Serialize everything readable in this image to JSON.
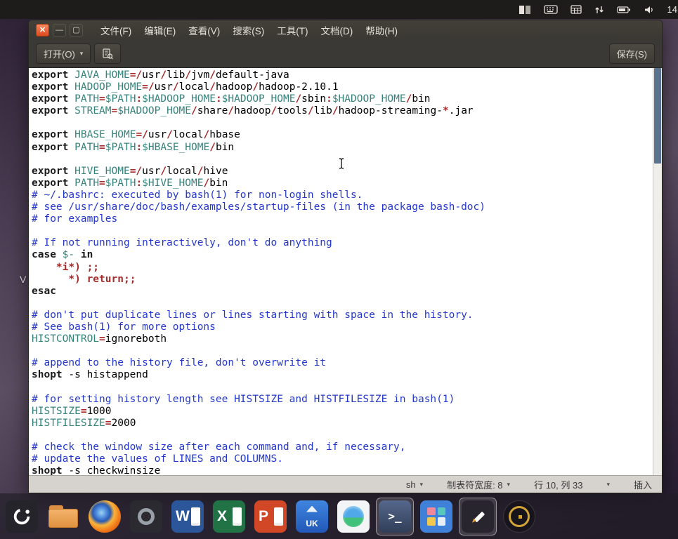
{
  "top_panel": {
    "clock": "14",
    "icons": [
      "input-method",
      "keyboard",
      "calendar",
      "sync-arrows",
      "battery",
      "volume"
    ]
  },
  "desktop": {
    "fragment_label": "V"
  },
  "window": {
    "titlebar": {
      "menus": [
        {
          "label": "文件(F)"
        },
        {
          "label": "编辑(E)"
        },
        {
          "label": "查看(V)"
        },
        {
          "label": "搜索(S)"
        },
        {
          "label": "工具(T)"
        },
        {
          "label": "文档(D)"
        },
        {
          "label": "帮助(H)"
        }
      ]
    },
    "toolbar": {
      "open_label": "打开(O)",
      "save_label": "保存(S)"
    },
    "statusbar": {
      "language_mode": "sh",
      "tab_width": "制表符宽度: 8",
      "cursor_position": "行 10, 列 33",
      "input_mode": "插入"
    }
  },
  "editor": {
    "syntax_colors": {
      "keyword": "#1c1c1c",
      "operator": "#a52a2a",
      "variable": "#36837b",
      "comment": "#2438c9",
      "plain": "#000000"
    },
    "lines": [
      [
        {
          "s": "kw",
          "t": "export"
        },
        {
          "s": "pl",
          "t": " "
        },
        {
          "s": "vr",
          "t": "JAVA_HOME"
        },
        {
          "s": "op",
          "t": "=/"
        },
        {
          "s": "pl",
          "t": "usr"
        },
        {
          "s": "op",
          "t": "/"
        },
        {
          "s": "pl",
          "t": "lib"
        },
        {
          "s": "op",
          "t": "/"
        },
        {
          "s": "pl",
          "t": "jvm"
        },
        {
          "s": "op",
          "t": "/"
        },
        {
          "s": "pl",
          "t": "default-java"
        }
      ],
      [
        {
          "s": "kw",
          "t": "export"
        },
        {
          "s": "pl",
          "t": " "
        },
        {
          "s": "vr",
          "t": "HADOOP_HOME"
        },
        {
          "s": "op",
          "t": "=/"
        },
        {
          "s": "pl",
          "t": "usr"
        },
        {
          "s": "op",
          "t": "/"
        },
        {
          "s": "pl",
          "t": "local"
        },
        {
          "s": "op",
          "t": "/"
        },
        {
          "s": "pl",
          "t": "hadoop"
        },
        {
          "s": "op",
          "t": "/"
        },
        {
          "s": "pl",
          "t": "hadoop-2.10.1"
        }
      ],
      [
        {
          "s": "kw",
          "t": "export"
        },
        {
          "s": "pl",
          "t": " "
        },
        {
          "s": "vr",
          "t": "PATH"
        },
        {
          "s": "op",
          "t": "="
        },
        {
          "s": "vr",
          "t": "$PATH"
        },
        {
          "s": "op",
          "t": ":"
        },
        {
          "s": "vr",
          "t": "$HADOOP_HOME"
        },
        {
          "s": "op",
          "t": ":"
        },
        {
          "s": "vr",
          "t": "$HADOOP_HOME"
        },
        {
          "s": "op",
          "t": "/"
        },
        {
          "s": "pl",
          "t": "sbin"
        },
        {
          "s": "op",
          "t": ":"
        },
        {
          "s": "vr",
          "t": "$HADOOP_HOME"
        },
        {
          "s": "op",
          "t": "/"
        },
        {
          "s": "pl",
          "t": "bin"
        }
      ],
      [
        {
          "s": "kw",
          "t": "export"
        },
        {
          "s": "pl",
          "t": " "
        },
        {
          "s": "vr",
          "t": "STREAM"
        },
        {
          "s": "op",
          "t": "="
        },
        {
          "s": "vr",
          "t": "$HADOOP_HOME"
        },
        {
          "s": "op",
          "t": "/"
        },
        {
          "s": "pl",
          "t": "share"
        },
        {
          "s": "op",
          "t": "/"
        },
        {
          "s": "pl",
          "t": "hadoop"
        },
        {
          "s": "op",
          "t": "/"
        },
        {
          "s": "pl",
          "t": "tools"
        },
        {
          "s": "op",
          "t": "/"
        },
        {
          "s": "pl",
          "t": "lib"
        },
        {
          "s": "op",
          "t": "/"
        },
        {
          "s": "pl",
          "t": "hadoop-streaming-"
        },
        {
          "s": "op",
          "t": "*"
        },
        {
          "s": "pl",
          "t": ".jar"
        }
      ],
      [],
      [
        {
          "s": "kw",
          "t": "export"
        },
        {
          "s": "pl",
          "t": " "
        },
        {
          "s": "vr",
          "t": "HBASE_HOME"
        },
        {
          "s": "op",
          "t": "=/"
        },
        {
          "s": "pl",
          "t": "usr"
        },
        {
          "s": "op",
          "t": "/"
        },
        {
          "s": "pl",
          "t": "local"
        },
        {
          "s": "op",
          "t": "/"
        },
        {
          "s": "pl",
          "t": "hbase"
        }
      ],
      [
        {
          "s": "kw",
          "t": "export"
        },
        {
          "s": "pl",
          "t": " "
        },
        {
          "s": "vr",
          "t": "PATH"
        },
        {
          "s": "op",
          "t": "="
        },
        {
          "s": "vr",
          "t": "$PATH"
        },
        {
          "s": "op",
          "t": ":"
        },
        {
          "s": "vr",
          "t": "$HBASE_HOME"
        },
        {
          "s": "op",
          "t": "/"
        },
        {
          "s": "pl",
          "t": "bin"
        }
      ],
      [],
      [
        {
          "s": "kw",
          "t": "export"
        },
        {
          "s": "pl",
          "t": " "
        },
        {
          "s": "vr",
          "t": "HIVE_HOME"
        },
        {
          "s": "op",
          "t": "=/"
        },
        {
          "s": "pl",
          "t": "usr"
        },
        {
          "s": "op",
          "t": "/"
        },
        {
          "s": "pl",
          "t": "local"
        },
        {
          "s": "op",
          "t": "/"
        },
        {
          "s": "pl",
          "t": "hive"
        }
      ],
      [
        {
          "s": "kw",
          "t": "export"
        },
        {
          "s": "pl",
          "t": " "
        },
        {
          "s": "vr",
          "t": "PATH"
        },
        {
          "s": "op",
          "t": "="
        },
        {
          "s": "vr",
          "t": "$PATH"
        },
        {
          "s": "op",
          "t": ":"
        },
        {
          "s": "vr",
          "t": "$HIVE_HOME"
        },
        {
          "s": "op",
          "t": "/"
        },
        {
          "s": "pl",
          "t": "bin"
        }
      ],
      [
        {
          "s": "cm",
          "t": "# ~/.bashrc: executed by bash(1) for non-login shells."
        }
      ],
      [
        {
          "s": "cm",
          "t": "# see /usr/share/doc/bash/examples/startup-files (in the package bash-doc)"
        }
      ],
      [
        {
          "s": "cm",
          "t": "# for examples"
        }
      ],
      [],
      [
        {
          "s": "cm",
          "t": "# If not running interactively, don't do anything"
        }
      ],
      [
        {
          "s": "kw",
          "t": "case"
        },
        {
          "s": "pl",
          "t": " "
        },
        {
          "s": "vr",
          "t": "$-"
        },
        {
          "s": "pl",
          "t": " "
        },
        {
          "s": "kw",
          "t": "in"
        }
      ],
      [
        {
          "s": "pl",
          "t": "    "
        },
        {
          "s": "op",
          "t": "*i*) ;;"
        }
      ],
      [
        {
          "s": "pl",
          "t": "      "
        },
        {
          "s": "op",
          "t": "*) return;;"
        }
      ],
      [
        {
          "s": "kw",
          "t": "esac"
        }
      ],
      [],
      [
        {
          "s": "cm",
          "t": "# don't put duplicate lines or lines starting with space in the history."
        }
      ],
      [
        {
          "s": "cm",
          "t": "# See bash(1) for more options"
        }
      ],
      [
        {
          "s": "vr",
          "t": "HISTCONTROL"
        },
        {
          "s": "op",
          "t": "="
        },
        {
          "s": "pl",
          "t": "ignoreboth"
        }
      ],
      [],
      [
        {
          "s": "cm",
          "t": "# append to the history file, don't overwrite it"
        }
      ],
      [
        {
          "s": "kw",
          "t": "shopt"
        },
        {
          "s": "pl",
          "t": " -s histappend"
        }
      ],
      [],
      [
        {
          "s": "cm",
          "t": "# for setting history length see HISTSIZE and HISTFILESIZE in bash(1)"
        }
      ],
      [
        {
          "s": "vr",
          "t": "HISTSIZE"
        },
        {
          "s": "op",
          "t": "="
        },
        {
          "s": "pl",
          "t": "1000"
        }
      ],
      [
        {
          "s": "vr",
          "t": "HISTFILESIZE"
        },
        {
          "s": "op",
          "t": "="
        },
        {
          "s": "pl",
          "t": "2000"
        }
      ],
      [],
      [
        {
          "s": "cm",
          "t": "# check the window size after each command and, if necessary,"
        }
      ],
      [
        {
          "s": "cm",
          "t": "# update the values of LINES and COLUMNS."
        }
      ],
      [
        {
          "s": "kw",
          "t": "shopt"
        },
        {
          "s": "pl",
          "t": " -s checkwinsize"
        }
      ]
    ]
  },
  "dock": {
    "items": [
      {
        "name": "ubuntu-kylin-menu"
      },
      {
        "name": "files"
      },
      {
        "name": "firefox"
      },
      {
        "name": "screenshot-tool"
      },
      {
        "name": "wps-writer",
        "glyph": "W"
      },
      {
        "name": "wps-spreadsheet",
        "glyph": "X"
      },
      {
        "name": "wps-presentation",
        "glyph": "P"
      },
      {
        "name": "software-center",
        "glyph": "UK"
      },
      {
        "name": "browser"
      },
      {
        "name": "terminal",
        "glyph": ">_",
        "active": true
      },
      {
        "name": "app-store-grid"
      },
      {
        "name": "note-editor",
        "active": true
      },
      {
        "name": "kylin-assistant"
      }
    ]
  }
}
